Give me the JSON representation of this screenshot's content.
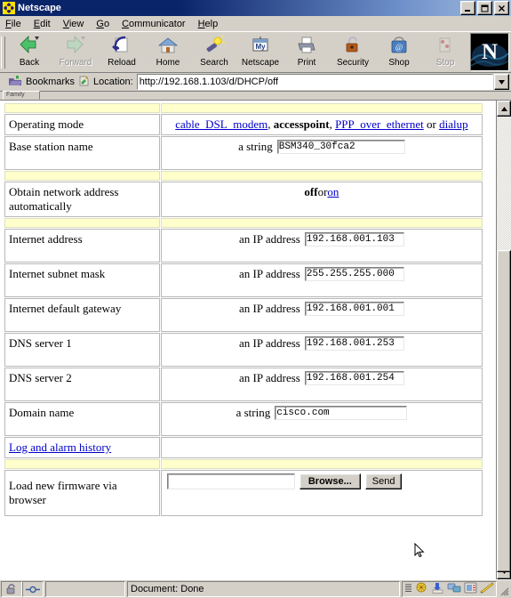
{
  "window": {
    "title": "Netscape",
    "app_icon": "netscape-ship-icon",
    "minimize": "_",
    "maximize": "❐",
    "close": "✕"
  },
  "menubar": {
    "items": [
      {
        "label": "File",
        "accesskey": "F"
      },
      {
        "label": "Edit",
        "accesskey": "E"
      },
      {
        "label": "View",
        "accesskey": "V"
      },
      {
        "label": "Go",
        "accesskey": "G"
      },
      {
        "label": "Communicator",
        "accesskey": "C"
      },
      {
        "label": "Help",
        "accesskey": "H"
      }
    ]
  },
  "toolbar": {
    "buttons": [
      {
        "label": "Back",
        "icon": "back-arrow-icon",
        "disabled": false
      },
      {
        "label": "Forward",
        "icon": "forward-arrow-icon",
        "disabled": true
      },
      {
        "label": "Reload",
        "icon": "reload-icon",
        "disabled": false
      },
      {
        "label": "Home",
        "icon": "home-icon",
        "disabled": false
      },
      {
        "label": "Search",
        "icon": "search-flashlight-icon",
        "disabled": false
      },
      {
        "label": "Netscape",
        "icon": "my-netscape-icon",
        "disabled": false
      },
      {
        "label": "Print",
        "icon": "printer-icon",
        "disabled": false
      },
      {
        "label": "Security",
        "icon": "padlock-icon",
        "disabled": false
      },
      {
        "label": "Shop",
        "icon": "shopping-bag-icon",
        "disabled": false
      },
      {
        "label": "Stop",
        "icon": "stop-icon",
        "disabled": true
      }
    ],
    "logo_letter": "N"
  },
  "locationbar": {
    "bookmarks_label": "Bookmarks",
    "bookmarks_icon": "bookmark-folder-icon",
    "location_label": "Location:",
    "location_icon": "page-icon",
    "url": "http://192.168.1.103/d/DHCP/off",
    "dropdown_icon": "chevron-down-icon"
  },
  "personal_toolbar": {
    "tabs": [
      "Family"
    ]
  },
  "page": {
    "rows": [
      {
        "type": "spacer"
      },
      {
        "type": "links",
        "label": "Operating mode",
        "options": [
          {
            "text": "cable_DSL_modem",
            "selected": false
          },
          {
            "text": "accesspoint",
            "selected": true
          },
          {
            "text": "PPP_over_ethernet",
            "selected": false
          },
          {
            "text": "dialup",
            "selected": false
          }
        ],
        "separator": ", ",
        "last_separator": " or "
      },
      {
        "type": "input",
        "label": "Base station name",
        "hint": "a string",
        "value": "BSM340_30fca2",
        "width": "w-name"
      },
      {
        "type": "spacer"
      },
      {
        "type": "toggle",
        "label": "Obtain network address automatically",
        "options": [
          {
            "text": "off",
            "selected": true
          },
          {
            "text": "on",
            "selected": false
          }
        ],
        "separator": " or "
      },
      {
        "type": "spacer"
      },
      {
        "type": "input",
        "label": "Internet address",
        "hint": "an IP address",
        "value": "192.168.001.103",
        "width": "w-ip"
      },
      {
        "type": "input",
        "label": "Internet subnet mask",
        "hint": "an IP address",
        "value": "255.255.255.000",
        "width": "w-ip"
      },
      {
        "type": "input",
        "label": "Internet default gateway",
        "hint": "an IP address",
        "value": "192.168.001.001",
        "width": "w-ip"
      },
      {
        "type": "input",
        "label": "DNS server 1",
        "hint": "an IP address",
        "value": "192.168.001.253",
        "width": "w-ip"
      },
      {
        "type": "input",
        "label": "DNS server 2",
        "hint": "an IP address",
        "value": "192.168.001.254",
        "width": "w-ip"
      },
      {
        "type": "input",
        "label": "Domain name",
        "hint": "a string",
        "value": "cisco.com",
        "width": "w-dom"
      },
      {
        "type": "link_row",
        "label": "Log and alarm history"
      },
      {
        "type": "spacer"
      },
      {
        "type": "firmware",
        "label": "Load new firmware via browser",
        "file_value": "",
        "browse_label": "Browse...",
        "send_label": "Send"
      }
    ]
  },
  "scrollbar": {
    "up_icon": "scroll-up-icon",
    "down_icon": "scroll-down-icon"
  },
  "statusbar": {
    "security_icon": "unlocked-padlock-icon",
    "connection_icon": "connection-icon",
    "message": "Document: Done",
    "tray_icons": [
      "menu-lines-icon",
      "navigator-icon",
      "mailbox-icon",
      "discussion-icon",
      "address-book-icon",
      "composer-icon"
    ],
    "resize_grip": "resize-grip-icon"
  }
}
